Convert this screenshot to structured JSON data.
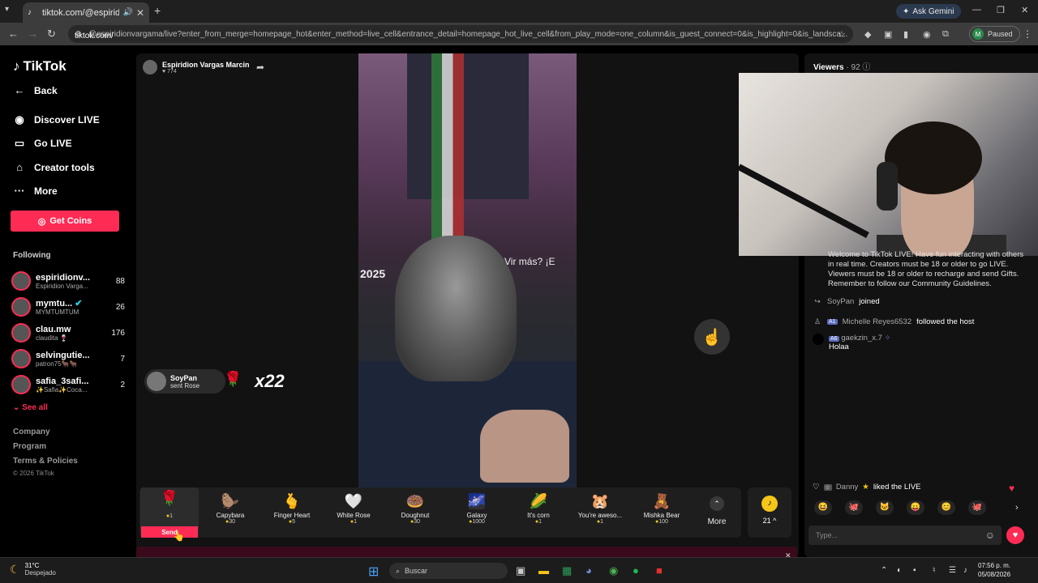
{
  "browser": {
    "tab_title": "tiktok.com/@espiridionvarg",
    "url_host": "tiktok.com/",
    "url_rest": "@espiridionvargama/live?enter_from_merge=homepage_hot&enter_method=live_cell&entrance_detail=homepage_hot_live_cell&from_play_mode=one_column&is_guest_connect=0&is_highlight=0&is_landsca...",
    "ask_gemini": "Ask Gemini",
    "paused": "Paused",
    "profile_initial": "M"
  },
  "sidebar": {
    "logo": "TikTok",
    "nav": [
      {
        "label": "Back",
        "icon": "arrow-left-icon"
      },
      {
        "label": "Discover LIVE",
        "icon": "live-avatar-icon"
      },
      {
        "label": "Go LIVE",
        "icon": "camera-icon"
      },
      {
        "label": "Creator tools",
        "icon": "lightbulb-icon"
      },
      {
        "label": "More",
        "icon": "dots-icon"
      }
    ],
    "get_coins": "Get Coins",
    "following_header": "Following",
    "following": [
      {
        "name": "espiridionv...",
        "sub": "Espiridion Varga...",
        "count": "88"
      },
      {
        "name": "mymtu...",
        "sub": "MYMTUMTUM",
        "count": "26"
      },
      {
        "name": "clau.mw",
        "sub": "claudita 🍷",
        "count": "176"
      },
      {
        "name": "selvingutie...",
        "sub": "patron75🐂🐂",
        "count": "7"
      },
      {
        "name": "safia_3safi...",
        "sub": "✨Safia✨Coca...",
        "count": "2"
      }
    ],
    "see_all": "See all",
    "footer": [
      "Company",
      "Program",
      "Terms & Policies"
    ],
    "copyright": "© 2026 TikTok"
  },
  "live": {
    "host_name": "Espiridion Vargas Marcin",
    "host_viewers": "774",
    "video_text_year": "2025",
    "video_text_more": "Vir más? ¡E",
    "gift_banner": {
      "user": "SoyPan",
      "action": "sent Rose",
      "combo": "x22"
    },
    "gifts": [
      {
        "name": "",
        "price": "1",
        "emoji": "🌹",
        "send_label": "Send"
      },
      {
        "name": "Capybara",
        "price": "30",
        "emoji": "🦫"
      },
      {
        "name": "Finger Heart",
        "price": "5",
        "emoji": "🫰"
      },
      {
        "name": "White Rose",
        "price": "1",
        "emoji": "🤍"
      },
      {
        "name": "Doughnut",
        "price": "30",
        "emoji": "🍩"
      },
      {
        "name": "Galaxy",
        "price": "1000",
        "emoji": "🌌"
      },
      {
        "name": "It's corn",
        "price": "1",
        "emoji": "🌽"
      },
      {
        "name": "You're aweso...",
        "price": "1",
        "emoji": "🐹"
      },
      {
        "name": "Mishka Bear",
        "price": "100",
        "emoji": "🧸"
      }
    ],
    "more_label": "More",
    "coins_value": "21"
  },
  "chat": {
    "viewers_label": "Viewers",
    "viewers_count": "· 92",
    "system_message": "Welcome to TikTok LIVE! Have fun interacting with others in real time. Creators must be 18 or older to go LIVE. Viewers must be 18 or older to recharge and send Gifts. Remember to follow our Community Guidelines.",
    "messages": [
      {
        "user": "SoyPan",
        "text": "joined",
        "level": ""
      },
      {
        "user": "Michelle Reyes6532",
        "text": "followed the host",
        "level": "1"
      },
      {
        "user": "gaekzin_x.7",
        "text": "Holaa",
        "level": "6"
      }
    ],
    "like_user": "Danny",
    "like_text": "liked the LIVE",
    "input_placeholder": "Type..."
  },
  "taskbar": {
    "temp": "31°C",
    "condition": "Despejado",
    "search_placeholder": "Buscar",
    "time": "07:56 p. m.",
    "date": "05/08/2026"
  }
}
